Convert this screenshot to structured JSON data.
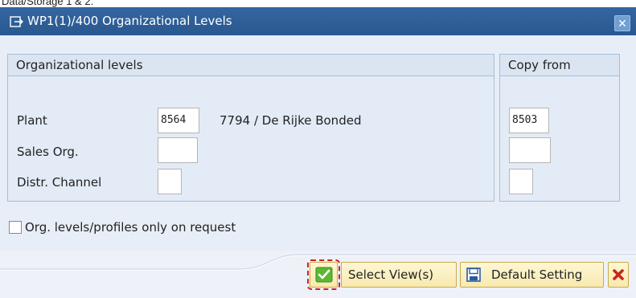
{
  "top_cut_text": "Data/Storage 1 & 2.",
  "window": {
    "title": "WP1(1)/400 Organizational Levels",
    "close_symbol": "✕"
  },
  "org_group": {
    "title": "Organizational levels",
    "rows": [
      {
        "label": "Plant",
        "value": "8564",
        "description": "7794 / De Rijke Bonded"
      },
      {
        "label": "Sales Org.",
        "value": "",
        "description": ""
      },
      {
        "label": "Distr. Channel",
        "value": "",
        "description": ""
      }
    ]
  },
  "copy_group": {
    "title": "Copy from",
    "values": [
      "8503",
      "",
      ""
    ]
  },
  "checkbox": {
    "label": "Org. levels/profiles only on request",
    "checked": false
  },
  "buttons": {
    "confirm_icon": "check-icon",
    "select_views_label": "Select View(s)",
    "default_setting_label": "Default Setting",
    "save_icon": "save-icon",
    "cancel_icon": "close-icon"
  },
  "colors": {
    "titlebar": "#2f5f98",
    "confirm_green": "#4aa321",
    "cancel_red": "#c8261b",
    "focus_red": "#d02020"
  }
}
